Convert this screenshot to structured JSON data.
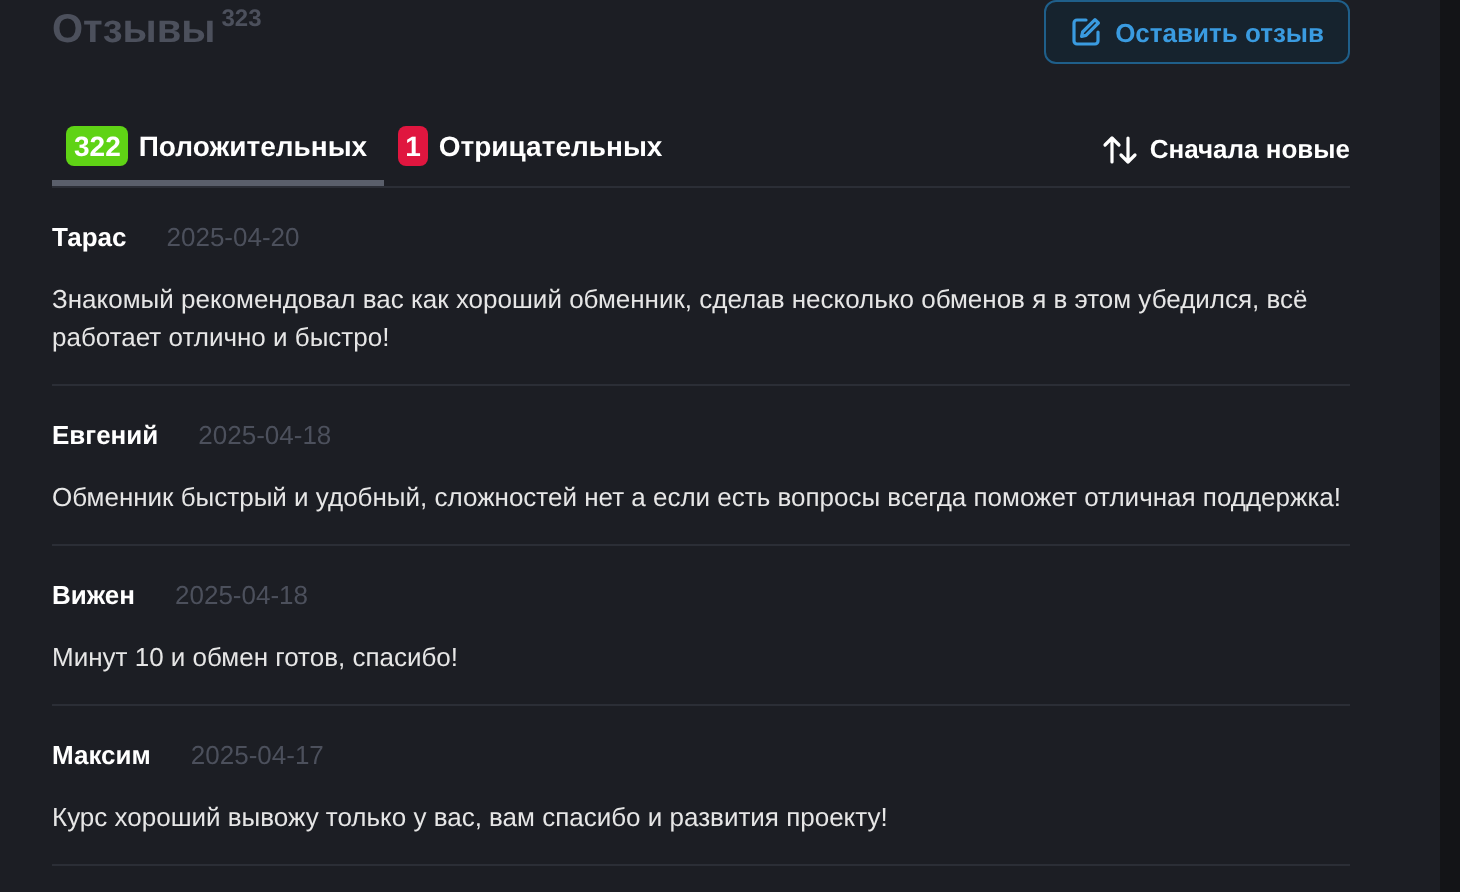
{
  "header": {
    "title": "Отзывы",
    "count": "323",
    "button": "Оставить отзыв"
  },
  "tabs": [
    {
      "count": "322",
      "label": "Положительных",
      "color": "#5fd315",
      "selected": true
    },
    {
      "count": "1",
      "label": "Отрицательных",
      "color": "#e0163f",
      "selected": false
    }
  ],
  "sort": {
    "label": "Сначала новые"
  },
  "reviews": [
    {
      "name": "Тарас",
      "date": "2025-04-20",
      "text": "Знакомый рекомендовал вас как хороший обменник, сделав несколько обменов я в этом убедился, всё работает отлично и быстро!"
    },
    {
      "name": "Евгений",
      "date": "2025-04-18",
      "text": "Обменник быстрый и удобный, сложностей нет а если есть вопросы всегда поможет отличная поддержка!"
    },
    {
      "name": "Вижен",
      "date": "2025-04-18",
      "text": "Минут 10 и обмен готов, спасибо!"
    },
    {
      "name": "Максим",
      "date": "2025-04-17",
      "text": "Курс хороший вывожу только у вас, вам спасибо и развития проекту!"
    }
  ]
}
